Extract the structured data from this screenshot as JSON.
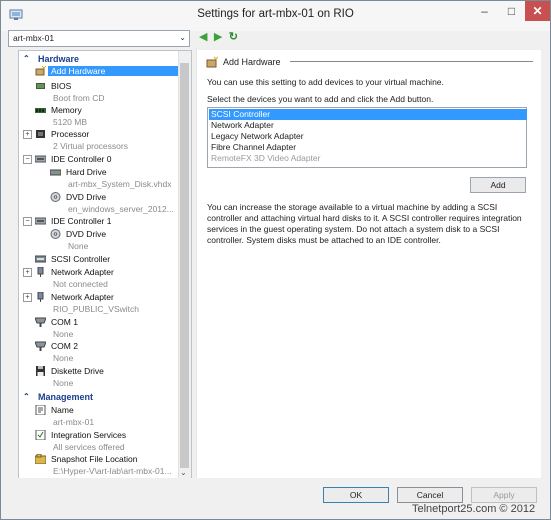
{
  "window": {
    "title": "Settings for art-mbx-01 on RIO",
    "min_glyph": "–",
    "max_glyph": "□",
    "close_glyph": "✕"
  },
  "vm_selector": {
    "value": "art-mbx-01",
    "chevron": "⌄"
  },
  "nav": {
    "back": "◀",
    "forward": "▶",
    "refresh": "↻"
  },
  "tree": {
    "hardware_label": "Hardware",
    "management_label": "Management",
    "section_chevron": "⌃",
    "items": [
      {
        "label": "Add Hardware",
        "sub": "",
        "selected": true
      },
      {
        "label": "BIOS",
        "sub": "Boot from CD"
      },
      {
        "label": "Memory",
        "sub": "5120 MB"
      },
      {
        "label": "Processor",
        "sub": "2 Virtual processors"
      },
      {
        "label": "IDE Controller 0",
        "sub": ""
      },
      {
        "label": "Hard Drive",
        "sub": "art-mbx_System_Disk.vhdx"
      },
      {
        "label": "DVD Drive",
        "sub": "en_windows_server_2012..."
      },
      {
        "label": "IDE Controller 1",
        "sub": ""
      },
      {
        "label": "DVD Drive",
        "sub": "None"
      },
      {
        "label": "SCSI Controller",
        "sub": ""
      },
      {
        "label": "Network Adapter",
        "sub": "Not connected"
      },
      {
        "label": "Network Adapter",
        "sub": "RIO_PUBLIC_VSwitch"
      },
      {
        "label": "COM 1",
        "sub": "None"
      },
      {
        "label": "COM 2",
        "sub": "None"
      },
      {
        "label": "Diskette Drive",
        "sub": "None"
      },
      {
        "label": "Name",
        "sub": "art-mbx-01"
      },
      {
        "label": "Integration Services",
        "sub": "All services offered"
      },
      {
        "label": "Snapshot File Location",
        "sub": "E:\\Hyper-V\\art-lab\\art-mbx-01..."
      }
    ],
    "expand_plus": "+",
    "expand_minus": "−"
  },
  "panel": {
    "header": "Add Hardware",
    "intro1": "You can use this setting to add devices to your virtual machine.",
    "intro2": "Select the devices you want to add and click the Add button.",
    "devices": [
      "SCSI Controller",
      "Network Adapter",
      "Legacy Network Adapter",
      "Fibre Channel Adapter",
      "RemoteFX 3D Video Adapter"
    ],
    "add_label": "Add",
    "note": "You can increase the storage available to a virtual machine by adding a SCSI controller and attaching virtual hard disks to it. A SCSI controller requires integration services in the guest operating system. Do not attach a system disk to a SCSI controller. System disks must be attached to an IDE controller."
  },
  "footer": {
    "ok": "OK",
    "cancel": "Cancel",
    "apply": "Apply"
  },
  "watermark": "Telnetport25.com © 2012",
  "colors": {
    "selection": "#3399ff",
    "section_header": "#1a3e8f",
    "close_button": "#c75050"
  }
}
